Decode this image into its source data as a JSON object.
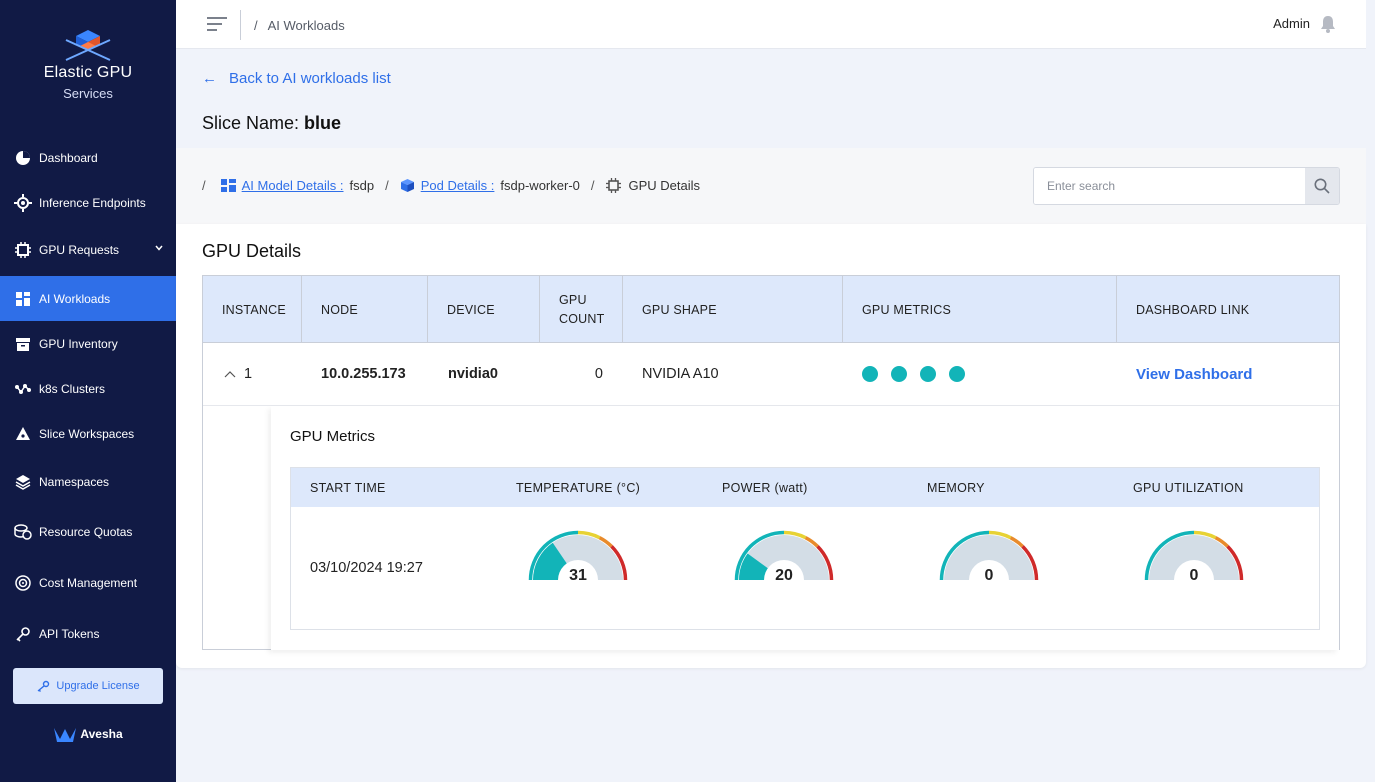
{
  "brand": {
    "title": "Elastic GPU",
    "subtitle": "Services"
  },
  "sidebar": {
    "items": [
      {
        "label": "Dashboard",
        "icon": "pie-chart-icon"
      },
      {
        "label": "Inference Endpoints",
        "icon": "gear-icon"
      },
      {
        "label": "GPU Requests",
        "icon": "chip-icon"
      },
      {
        "label": "AI Workloads",
        "icon": "grid-icon"
      },
      {
        "label": "GPU Inventory",
        "icon": "box-icon"
      },
      {
        "label": "k8s Clusters",
        "icon": "nodes-icon"
      },
      {
        "label": "Slice Workspaces",
        "icon": "slice-icon"
      },
      {
        "label": "Namespaces",
        "icon": "layers-icon"
      },
      {
        "label": "Resource Quotas",
        "icon": "coins-icon"
      },
      {
        "label": "Cost Management",
        "icon": "cost-icon"
      },
      {
        "label": "API Tokens",
        "icon": "key-icon"
      }
    ],
    "active": "AI Workloads",
    "upgrade_label": "Upgrade License",
    "footer_brand": "Avesha"
  },
  "topbar": {
    "crumb": "AI Workloads",
    "user": "Admin"
  },
  "page": {
    "back_label": "Back to AI workloads list",
    "slice_label": "Slice Name:",
    "slice_value": "blue"
  },
  "breadcrumb": {
    "model_link": "AI Model Details :",
    "model_value": "fsdp",
    "pod_link": "Pod Details :",
    "pod_value": "fsdp-worker-0",
    "current": "GPU Details"
  },
  "search": {
    "placeholder": "Enter search"
  },
  "gpu_details": {
    "title": "GPU Details",
    "columns": [
      "INSTANCE",
      "NODE",
      "DEVICE",
      "GPU COUNT",
      "GPU SHAPE",
      "GPU METRICS",
      "DASHBOARD LINK"
    ],
    "row": {
      "instance": "1",
      "node": "10.0.255.173",
      "device": "nvidia0",
      "gpu_count": "0",
      "gpu_shape": "NVIDIA A10",
      "dashboard_link": "View Dashboard"
    }
  },
  "gpu_metrics": {
    "title": "GPU Metrics",
    "columns": [
      "START TIME",
      "TEMPERATURE (°C)",
      "POWER (watt)",
      "MEMORY",
      "GPU UTILIZATION"
    ],
    "start_time": "03/10/2024 19:27",
    "gauges": [
      {
        "name": "temperature",
        "value": "31",
        "fraction": 0.31
      },
      {
        "name": "power",
        "value": "20",
        "fraction": 0.2
      },
      {
        "name": "memory",
        "value": "0",
        "fraction": 0
      },
      {
        "name": "gpu_utilization",
        "value": "0",
        "fraction": 0
      }
    ]
  },
  "colors": {
    "sidebar_bg": "#111a45",
    "accent": "#2f6fe8",
    "table_header": "#dde8fb",
    "gauge_fill": "#12b4b8",
    "gauge_track": "#d3dde6",
    "gauge_yellow": "#e7d234",
    "gauge_orange": "#e88b2c",
    "gauge_red": "#cf2a2a"
  }
}
